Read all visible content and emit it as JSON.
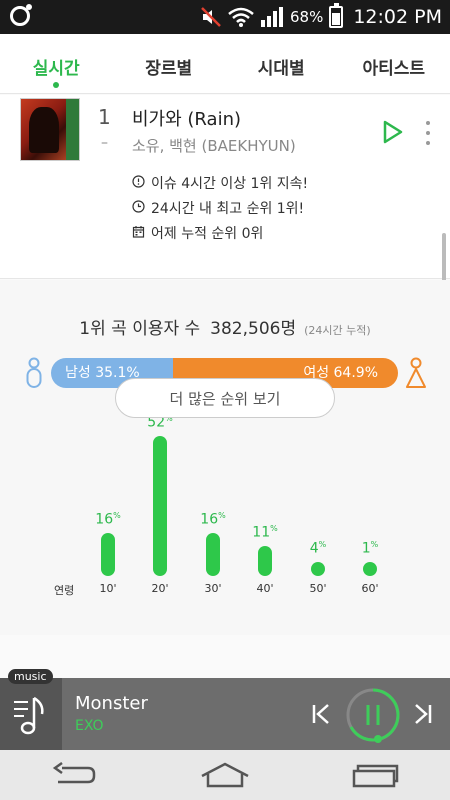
{
  "status_bar": {
    "battery_percent": "68%",
    "time": "12:02 PM",
    "battery_level": 0.68,
    "icons": [
      "app-logo-icon",
      "mute-icon",
      "wifi-icon",
      "signal-icon",
      "battery-charging-icon"
    ]
  },
  "tabs": [
    {
      "label": "실시간",
      "active": true
    },
    {
      "label": "장르별",
      "active": false
    },
    {
      "label": "시대별",
      "active": false
    },
    {
      "label": "아티스트",
      "active": false
    }
  ],
  "song": {
    "rank": "1",
    "rank_change": "–",
    "title": "비가와 (Rain)",
    "artist": "소유, 백현 (BAEKHYUN)",
    "info": [
      {
        "icon": "alert-clock-icon",
        "text": "이슈 4시간 이상 1위 지속!"
      },
      {
        "icon": "clock-icon",
        "text": "24시간 내 최고 순위 1위!"
      },
      {
        "icon": "calendar-icon",
        "text": "어제 누적 순위 0위"
      }
    ]
  },
  "stats": {
    "users_label": "1위 곡 이용자 수",
    "users_count": "382,506명",
    "users_note": "(24시간 누적)",
    "male_label": "남성 35.1%",
    "female_label": "여성 64.9%",
    "male_share": 0.351,
    "female_share": 0.649,
    "age_axis_label": "연령"
  },
  "chart_data": {
    "type": "bar",
    "categories": [
      "10'",
      "20'",
      "30'",
      "40'",
      "50'",
      "60'"
    ],
    "values": [
      16,
      52,
      16,
      11,
      4,
      1
    ],
    "unit": "%"
  },
  "more_button": {
    "label": "더 많은 순위 보기"
  },
  "player": {
    "badge": "music",
    "title": "Monster",
    "artist": "EXO"
  },
  "colors": {
    "accent_green": "#2db84d",
    "male_blue": "#7fb3e6",
    "female_orange": "#f08a2c"
  }
}
